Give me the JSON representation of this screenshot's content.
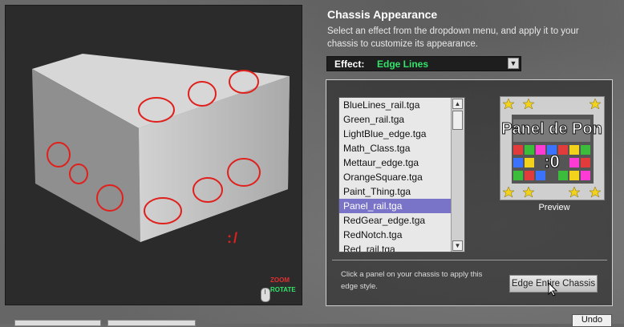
{
  "title": "Chassis Appearance",
  "description": "Select an effect from the dropdown menu, and apply it to your chassis to customize its appearance.",
  "effect": {
    "label": "Effect:",
    "value": "Edge Lines"
  },
  "list": {
    "items": [
      "BlueLines_rail.tga",
      "Green_rail.tga",
      "LightBlue_edge.tga",
      "Math_Class.tga",
      "Mettaur_edge.tga",
      "OrangeSquare.tga",
      "Paint_Thing.tga",
      "Panel_rail.tga",
      "RedGear_edge.tga",
      "RedNotch.tga",
      "Red_rail.tga"
    ],
    "selected_index": 7
  },
  "preview": {
    "label": "Preview",
    "image_text_line1": "Panel de Pon",
    "image_text_line2": ":0"
  },
  "instruction": "Click a panel on your chassis to apply this edge style.",
  "edge_button": "Edge Entire Chassis",
  "viewport": {
    "annotation": ":/",
    "zoom_label": "ZOOM",
    "rotate_label": "ROTATE"
  },
  "undo_button": "Undo",
  "colors": {
    "accent_green": "#33e36a",
    "selection": "#7a74c8",
    "annotation_red": "#e0201c"
  }
}
